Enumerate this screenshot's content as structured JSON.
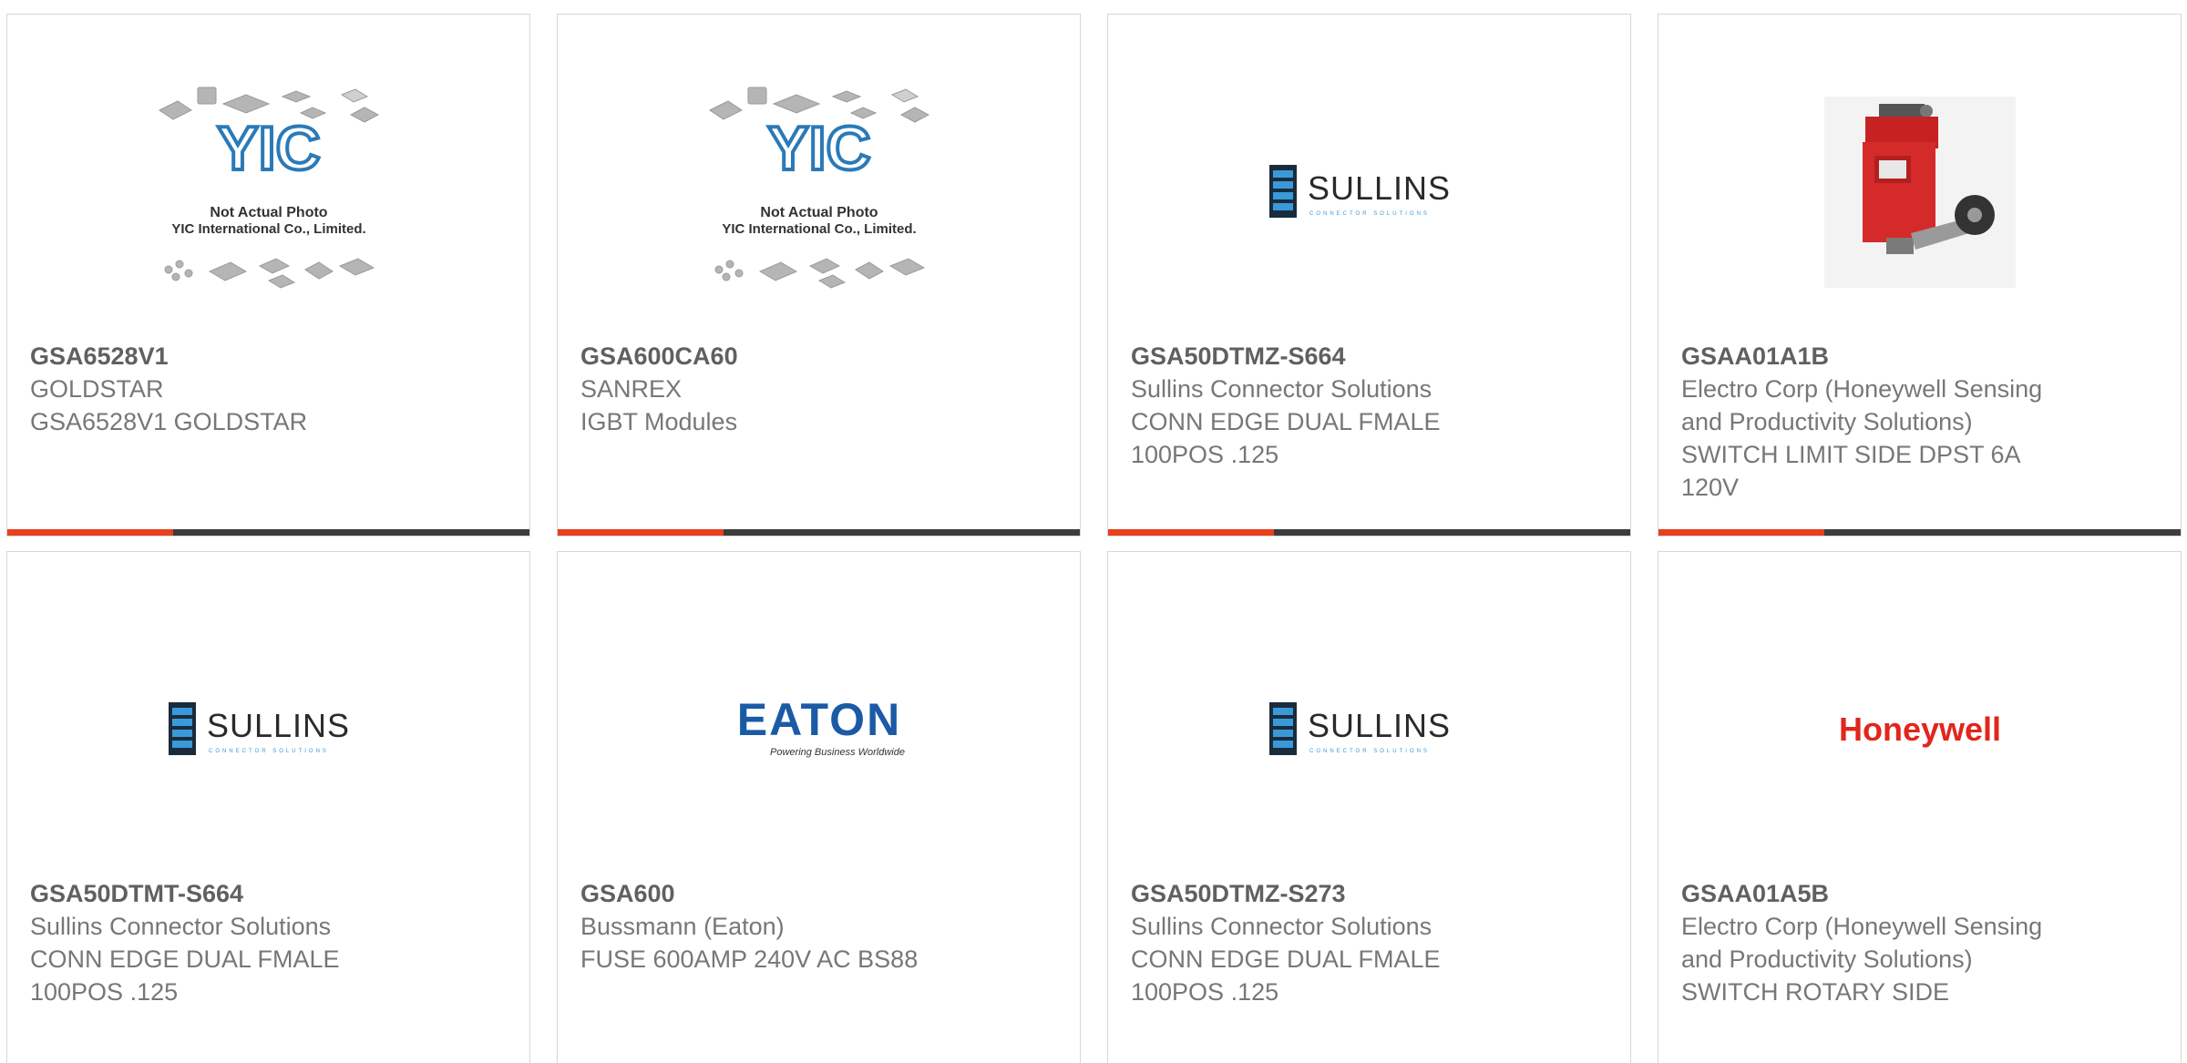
{
  "colors": {
    "accent": "#e8401c",
    "bar_dark": "#3c3c3c",
    "text_strong": "#606060",
    "text_muted": "#777777",
    "border": "#d7d7d7"
  },
  "logos": {
    "yic": {
      "monogram": "YIC",
      "line1": "Not Actual Photo",
      "line2": "YIC International Co., Limited."
    },
    "sullins": {
      "name": "SULLINS",
      "tagline": "CONNECTOR SOLUTIONS"
    },
    "eaton": {
      "name": "EATON",
      "tagline": "Powering Business Worldwide"
    },
    "honeywell": {
      "name": "Honeywell"
    }
  },
  "products": [
    {
      "part_number": "GSA6528V1",
      "manufacturer": "GOLDSTAR",
      "description": "GSA6528V1 GOLDSTAR",
      "image": "yic-placeholder-image"
    },
    {
      "part_number": "GSA600CA60",
      "manufacturer": "SANREX",
      "description": "IGBT Modules",
      "image": "yic-placeholder-image"
    },
    {
      "part_number": "GSA50DTMZ-S664",
      "manufacturer": "Sullins Connector Solutions",
      "description": "CONN EDGE DUAL FMALE 100POS .125",
      "image": "sullins-logo"
    },
    {
      "part_number": "GSAA01A1B",
      "manufacturer": "Electro Corp (Honeywell Sensing and Productivity Solutions)",
      "description": "SWITCH LIMIT SIDE DPST 6A 120V",
      "image": "limit-switch-photo"
    },
    {
      "part_number": "GSA50DTMT-S664",
      "manufacturer": "Sullins Connector Solutions",
      "description": "CONN EDGE DUAL FMALE 100POS .125",
      "image": "sullins-logo"
    },
    {
      "part_number": "GSA600",
      "manufacturer": "Bussmann (Eaton)",
      "description": "FUSE 600AMP 240V AC BS88",
      "image": "eaton-logo"
    },
    {
      "part_number": "GSA50DTMZ-S273",
      "manufacturer": "Sullins Connector Solutions",
      "description": "CONN EDGE DUAL FMALE 100POS .125",
      "image": "sullins-logo"
    },
    {
      "part_number": "GSAA01A5B",
      "manufacturer": "Electro Corp (Honeywell Sensing and Productivity Solutions)",
      "description": "SWITCH ROTARY SIDE",
      "image": "honeywell-logo"
    }
  ]
}
